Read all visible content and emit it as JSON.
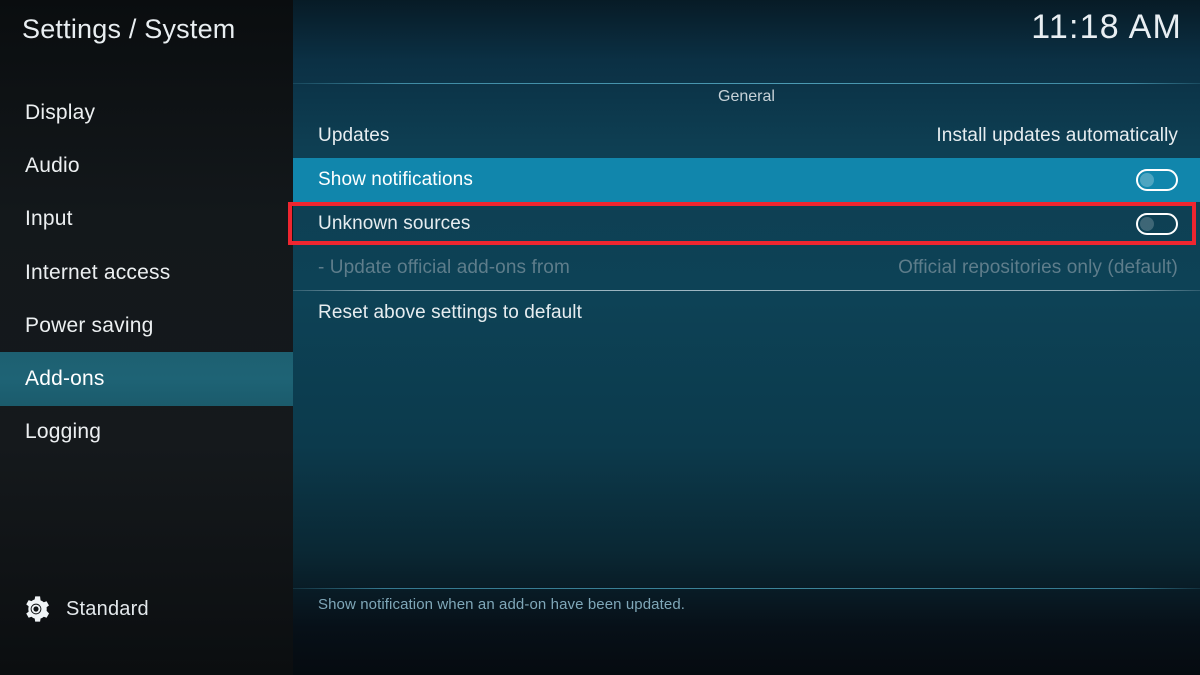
{
  "app": {
    "title": "Settings / System",
    "clock": "11:18 AM"
  },
  "sidebar": {
    "items": [
      {
        "label": "Display",
        "selected": false
      },
      {
        "label": "Audio",
        "selected": false
      },
      {
        "label": "Input",
        "selected": false
      },
      {
        "label": "Internet access",
        "selected": false
      },
      {
        "label": "Power saving",
        "selected": false
      },
      {
        "label": "Add-ons",
        "selected": true
      },
      {
        "label": "Logging",
        "selected": false
      }
    ],
    "profile": {
      "icon": "gear-icon",
      "label": "Standard"
    }
  },
  "main": {
    "section_title": "General",
    "rows": [
      {
        "label": "Updates",
        "value": "Install updates automatically",
        "control": "text",
        "selected": false,
        "disabled": false
      },
      {
        "label": "Show notifications",
        "value": "",
        "control": "toggle",
        "toggle_on": false,
        "selected": true,
        "disabled": false
      },
      {
        "label": "Unknown sources",
        "value": "",
        "control": "toggle",
        "toggle_on": false,
        "selected": false,
        "disabled": false,
        "annotated": true
      },
      {
        "label": "- Update official add-ons from",
        "value": "Official repositories only (default)",
        "control": "text",
        "selected": false,
        "disabled": true
      },
      {
        "label": "Reset above settings to default",
        "value": "",
        "control": "none",
        "selected": false,
        "disabled": false,
        "separator_above": true
      }
    ],
    "help_text": "Show notification when an add-on have been updated."
  },
  "colors": {
    "selected_row": "#1186ac",
    "sidebar_selected": "#1d6275",
    "annotation_red": "#ee2630",
    "panel_mid": "#0d4256",
    "disabled_text": "#5e7d8b",
    "help_text": "#7fa7b8"
  }
}
